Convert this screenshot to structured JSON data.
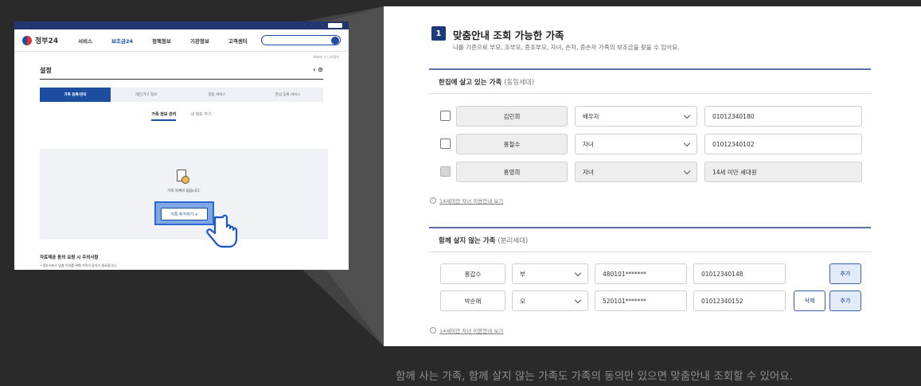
{
  "left_screenshot": {
    "logo": "정부24",
    "menu": [
      "서비스",
      "보조금24",
      "정책정보",
      "기관정보",
      "고객센터"
    ],
    "breadcrumb": "Home > 나의정보",
    "page_title": "설정",
    "tabs": [
      "가족 등록/관리",
      "개인/가구 정보",
      "알림 서비스",
      "관심 등록 서비스"
    ],
    "subtabs": [
      "가족 정보 관리",
      "내 정보 주기"
    ],
    "empty_message": "가족 목록이 없습니다.",
    "add_button": "가족 추가하기 +",
    "notice_title": "자료제공 동의 요청 시 주의사항",
    "notice_text": "• 정부서비스 맞춤 안내를 위해 가족의 동의가 필요합니다."
  },
  "zoom": {
    "step_number": "1",
    "heading": "맞춤안내 조회 가능한 가족",
    "description": "나를 기준으로 부모, 조부모, 증조부모, 자녀, 손자, 증손자 가족의 보조금을 찾을 수 있어요.",
    "section1": {
      "title": "한집에 살고 있는 가족",
      "subtitle": "(동일세대)",
      "rows": [
        {
          "name": "김민희",
          "relation": "배우자",
          "phone": "01012340180",
          "disabled": false
        },
        {
          "name": "홍철수",
          "relation": "자녀",
          "phone": "01012340102",
          "disabled": false
        },
        {
          "name": "홍영희",
          "relation": "자녀",
          "phone": "14세 미만 세대원",
          "disabled": true
        }
      ],
      "info": "14세미만 자녀 이용안내 보기"
    },
    "section2": {
      "title": "함께 살지 않는 가족",
      "subtitle": "(분리세대)",
      "rows": [
        {
          "name": "홍갑수",
          "relation": "부",
          "rrn": "480101*******",
          "phone": "01012340148",
          "delete": "",
          "add": "추가"
        },
        {
          "name": "박순애",
          "relation": "모",
          "rrn": "520101*******",
          "phone": "01012340152",
          "delete": "삭제",
          "add": "추가"
        }
      ],
      "info": "14세미만 자녀 이용안내 보기"
    }
  },
  "caption": "함께 사는 가족, 함께 살지 않는 가족도 가족의 동의만 있으면 맞춤안내 조회할 수 있어요."
}
